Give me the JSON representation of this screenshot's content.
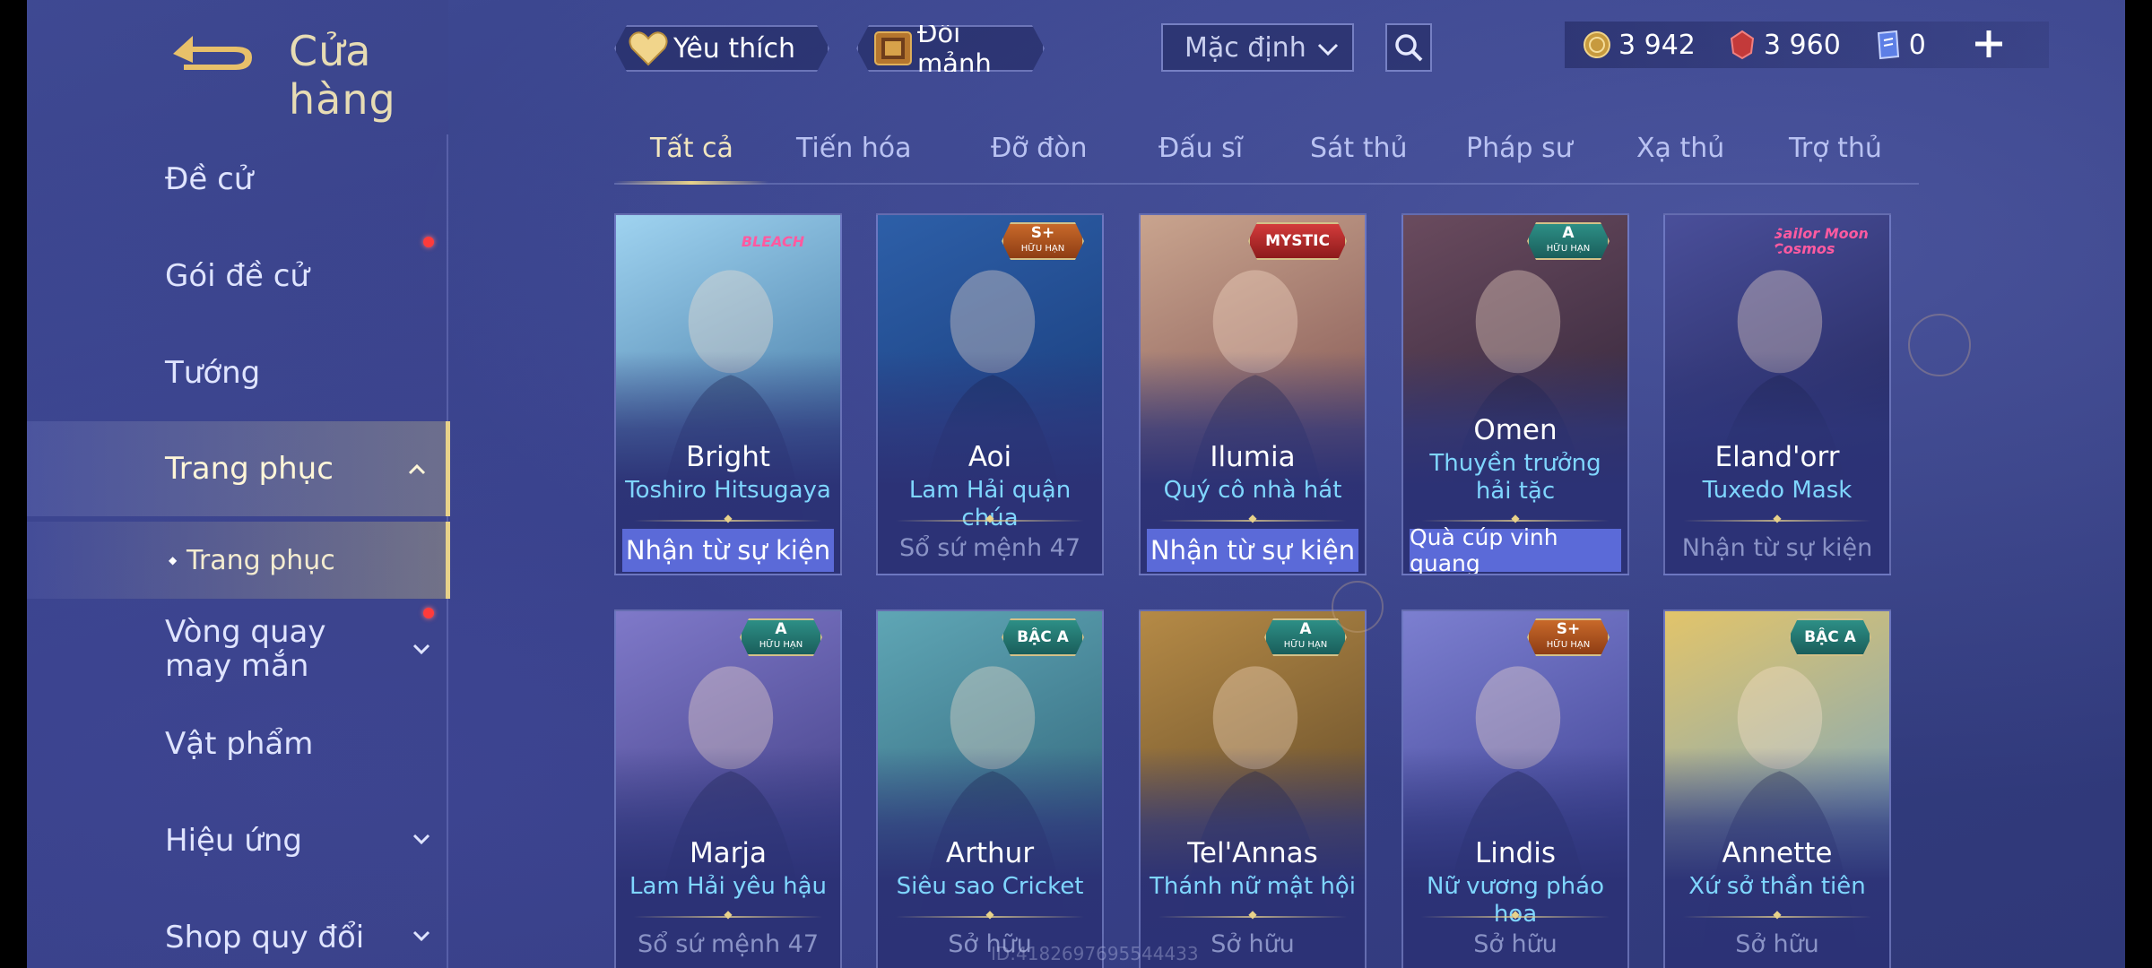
{
  "header": {
    "title": "Cửa hàng",
    "favorite_label": "Yêu thích",
    "exchange_label": "Đổi mảnh",
    "sort_value": "Mặc định",
    "currencies": [
      {
        "name": "gold-coin-icon",
        "amount": "3 942"
      },
      {
        "name": "ruby-gem-icon",
        "amount": "3 960"
      },
      {
        "name": "voucher-icon",
        "amount": "0"
      }
    ]
  },
  "sidebar": {
    "items": [
      {
        "label": "Đề cử"
      },
      {
        "label": "Gói đề cử"
      },
      {
        "label": "Tướng"
      },
      {
        "label": "Trang phục"
      },
      {
        "label": "Vòng quay may mắn"
      },
      {
        "label": "Vật phẩm"
      },
      {
        "label": "Hiệu ứng"
      },
      {
        "label": "Shop quy đổi"
      }
    ],
    "sub_item": "Trang phục"
  },
  "tabs": [
    "Tất cả",
    "Tiến hóa",
    "Đỡ đòn",
    "Đấu sĩ",
    "Sát thủ",
    "Pháp sư",
    "Xạ thủ",
    "Trợ thủ"
  ],
  "cards": [
    {
      "hero": "Bright",
      "skin": "Toshiro Hitsugaya",
      "action": "Nhận từ sự kiện",
      "badge": "BLEACH",
      "badge_type": "series",
      "colors": [
        "#9fd3f0",
        "#3a6f9c"
      ]
    },
    {
      "hero": "Aoi",
      "skin": "Lam Hải quận chúa",
      "status": "Sổ sứ mệnh 47",
      "badge": "S+",
      "badge_sub": "HỮU HẠN",
      "badge_type": "gold",
      "colors": [
        "#2d5fa8",
        "#183a78"
      ]
    },
    {
      "hero": "Ilumia",
      "skin": "Quý cô nhà hát",
      "action": "Nhận từ sự kiện",
      "badge": "MYSTIC",
      "badge_type": "red",
      "colors": [
        "#c9a48e",
        "#7b4d4d"
      ]
    },
    {
      "hero": "Omen",
      "skin": "Thuyền trưởng hải tặc",
      "action": "Quà cúp vinh quang",
      "badge": "A",
      "badge_sub": "HỮU HẠN",
      "badge_type": "teal",
      "colors": [
        "#6a4b5e",
        "#2d2238"
      ]
    },
    {
      "hero": "Eland'orr",
      "skin": "Tuxedo Mask",
      "status": "Nhận từ sự kiện",
      "badge": "Sailor Moon Cosmos",
      "badge_type": "series",
      "colors": [
        "#4a4f9a",
        "#1f2357"
      ]
    },
    {
      "hero": "Marja",
      "skin": "Lam Hải yêu hậu",
      "status": "Sổ sứ mệnh 47",
      "badge": "A",
      "badge_sub": "HỮU HẠN",
      "badge_type": "teal",
      "colors": [
        "#7f79c9",
        "#3d3a80"
      ]
    },
    {
      "hero": "Arthur",
      "skin": "Siêu sao Cricket",
      "status": "Sở hữu",
      "badge": "BẬC A",
      "badge_type": "teal",
      "colors": [
        "#5fa6b5",
        "#2d5f75"
      ]
    },
    {
      "hero": "Tel'Annas",
      "skin": "Thánh nữ mật hội",
      "status": "Sở hữu",
      "badge": "A",
      "badge_sub": "HỮU HẠN",
      "badge_type": "teal",
      "colors": [
        "#b58a46",
        "#5a4426"
      ]
    },
    {
      "hero": "Lindis",
      "skin": "Nữ vương pháo hoa",
      "status": "Sở hữu",
      "badge": "S+",
      "badge_sub": "HỮU HẠN",
      "badge_type": "gold",
      "colors": [
        "#7c7fd0",
        "#3a3d8e"
      ]
    },
    {
      "hero": "Annette",
      "skin": "Xứ sở thần tiên",
      "status": "Sở hữu",
      "badge": "BẬC A",
      "badge_type": "teal",
      "colors": [
        "#e2c46a",
        "#6fa3c9"
      ]
    }
  ],
  "watermark": "ID:41826976955444​33",
  "colors": {
    "accent_gold": "#e8d28a",
    "skin_name": "#7fd6ff",
    "action_button": "#5b6ad8",
    "notification": "#ff3b3b"
  }
}
